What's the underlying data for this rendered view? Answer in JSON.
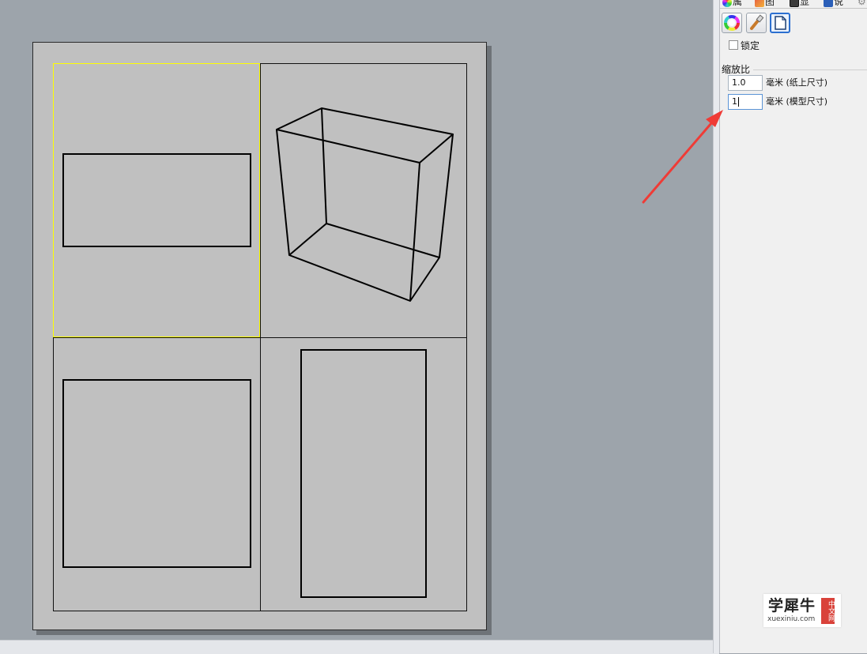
{
  "panel": {
    "tabs": [
      {
        "label": "属",
        "icon": "color-wheel-icon",
        "color": "#2a8a3a"
      },
      {
        "label": "图",
        "icon": "layers-icon",
        "color": "#d23c2a"
      },
      {
        "label": "显",
        "icon": "monitor-icon",
        "color": "#333333"
      },
      {
        "label": "说",
        "icon": "help-icon",
        "color": "#2b5fb8"
      }
    ],
    "tools": [
      {
        "icon": "color-wheel-icon"
      },
      {
        "icon": "brush-icon"
      },
      {
        "icon": "page-icon"
      }
    ],
    "lock_label": "锁定",
    "lock_checked": false,
    "scale": {
      "group_label": "缩放比",
      "paper_value": "1.0",
      "paper_unit": "毫米 (纸上尺寸)",
      "model_value": "1",
      "model_unit": "毫米 (模型尺寸)"
    }
  },
  "watermark": {
    "main": "学犀牛",
    "site": "xuexiniu.com",
    "badge": "中文网"
  },
  "colors": {
    "viewport_bg": "#9da4ab",
    "paper": "#c0c0c0",
    "active_detail": "#ffff00",
    "arrow": "#ef3b36",
    "accent": "#2b6fd0"
  }
}
